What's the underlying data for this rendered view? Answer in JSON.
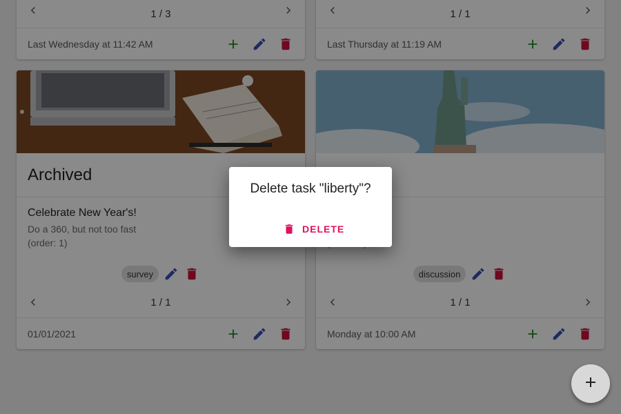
{
  "cards": {
    "top_left": {
      "pager": "1 / 3",
      "footer_date": "Last Wednesday at 11:42 AM"
    },
    "top_right": {
      "pager": "1 / 1",
      "footer_date": "Last Thursday at 11:19 AM"
    },
    "bottom_left": {
      "image": "laptop-notebook-photo",
      "title": "Archived",
      "task_title": "Celebrate New Year's!",
      "task_desc": "Do a 360, but not too fast",
      "task_order": "(order: 1)",
      "tag": "survey",
      "pager": "1 / 1",
      "footer_date": "01/01/2021"
    },
    "bottom_right": {
      "image": "statue-of-liberty-photo",
      "task_order": "(order: 0)",
      "tag": "discussion",
      "pager": "1 / 1",
      "footer_date": "Monday at 10:00 AM"
    }
  },
  "dialog": {
    "title": "Delete task \"liberty\"?",
    "delete_label": "DELETE"
  },
  "icons": {
    "add": "plus-icon",
    "edit": "pencil-icon",
    "delete": "trash-icon",
    "prev": "chevron-left-icon",
    "next": "chevron-right-icon",
    "fab": "plus-icon"
  },
  "colors": {
    "add": "#1b8a1b",
    "edit": "#3a4fb4",
    "delete": "#d0103a",
    "dialog_action": "#e0115f",
    "background": "#2a2a2e"
  }
}
